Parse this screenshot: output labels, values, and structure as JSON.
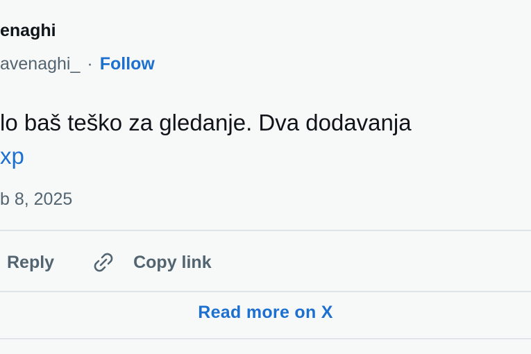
{
  "author": {
    "display_name": "enaghi",
    "handle": "avenaghi_",
    "separator": "·",
    "follow_label": "Follow"
  },
  "tweet": {
    "text": "lo baš teško za gledanje. Dva dodavanja",
    "link_text": "xp",
    "date": "b 8, 2025"
  },
  "actions": {
    "reply_label": "Reply",
    "copy_link_label": "Copy link",
    "copy_link_icon": "link-icon"
  },
  "footer": {
    "read_more_label": "Read more on X"
  },
  "colors": {
    "background": "#f7f9f9",
    "text": "#0f1419",
    "muted": "#536471",
    "link": "#1d6fd0",
    "divider": "#dfe4e8"
  }
}
